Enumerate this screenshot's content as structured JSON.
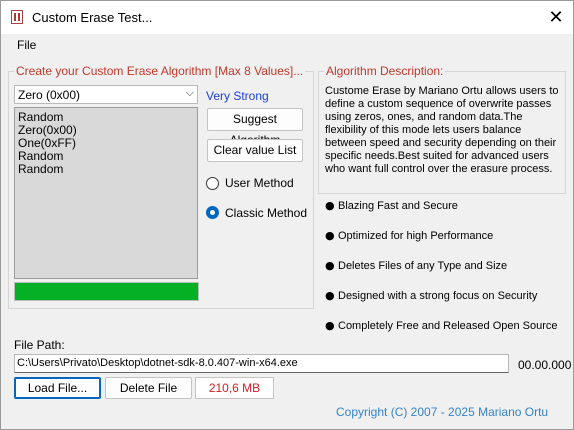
{
  "window": {
    "title": "Custom Erase Test...",
    "close_glyph": "✕"
  },
  "menu": {
    "file": "File"
  },
  "algorithm_group": {
    "legend": "Create your Custom Erase Algorithm [Max 8 Values]...",
    "combo_value": "Zero (0x00)",
    "strength": "Very Strong",
    "passes": [
      "Random",
      "Zero(0x00)",
      "One(0xFF)",
      "Random",
      "Random"
    ],
    "progress_percent": 100,
    "progress_color": "#06b025",
    "suggest_button": "Suggest Algorithm",
    "clear_button": "Clear value List",
    "method_options": [
      {
        "label": "User Method",
        "checked": false
      },
      {
        "label": "Classic Method",
        "checked": true
      }
    ]
  },
  "description_group": {
    "legend": "Algorithm Description:",
    "text": "Custome Erase by Mariano Ortu allows users to define a custom sequence of overwrite passes using zeros, ones, and random data.The flexibility of this mode lets users balance between speed and security depending on their specific needs.Best suited for advanced users who want full control over the erasure process."
  },
  "features": [
    "Blazing Fast and Secure",
    "Optimized for high Performance",
    "Deletes Files of any Type and Size",
    "Designed with a strong focus on Security",
    "Completely Free and Released Open Source"
  ],
  "file": {
    "label": "File Path:",
    "path": "C:\\Users\\Privato\\Desktop\\dotnet-sdk-8.0.407-win-x64.exe",
    "time": "00.00.000",
    "load_button": "Load File...",
    "delete_button": "Delete File",
    "size": "210,6 MB"
  },
  "footer": {
    "copyright": "Copyright (C) 2007 - 2025 Mariano Ortu"
  },
  "colors": {
    "accent": "#0067c0",
    "legend": "#c0392b",
    "strength": "#1a3fd6",
    "size": "#d02020",
    "copyright": "#3483c6"
  }
}
